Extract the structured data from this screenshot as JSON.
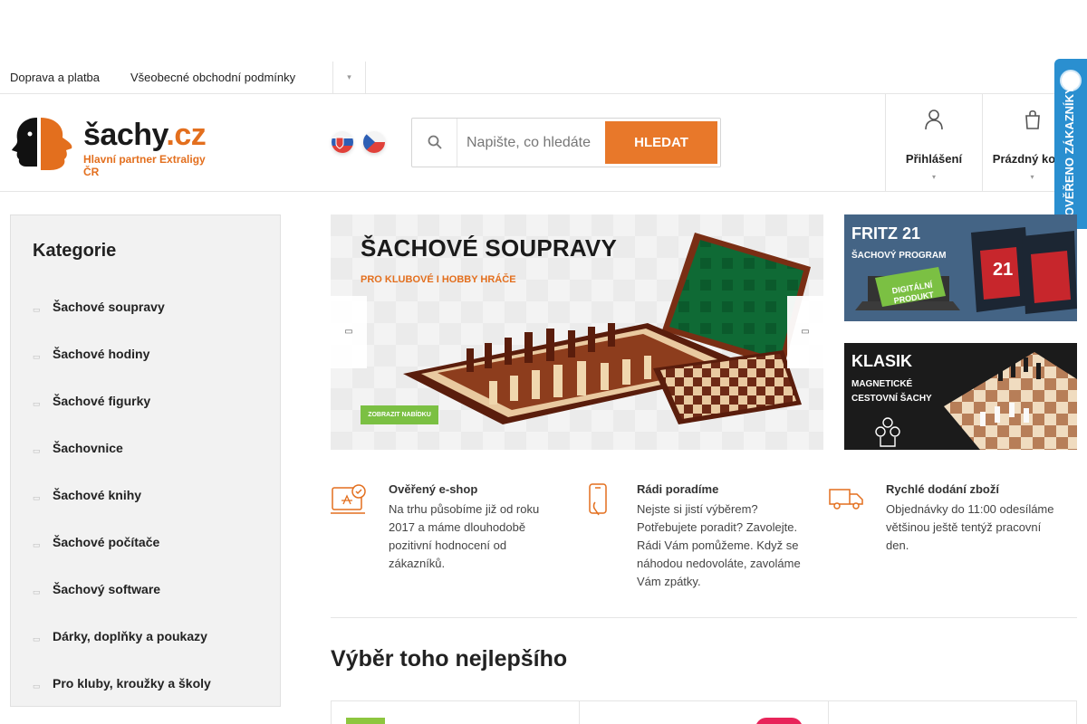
{
  "top_links": {
    "shipping": "Doprava a platba",
    "terms": "Všeobecné obchodní podmínky"
  },
  "logo": {
    "name": "šachy",
    "tld": ".cz",
    "tagline": "Hlavní partner Extraligy ČR"
  },
  "search": {
    "placeholder": "Napište, co hledáte",
    "button": "HLEDAT"
  },
  "header": {
    "login_label": "Přihlášení",
    "cart_label": "Prázdný košík"
  },
  "verified_badge": {
    "text": "OVĚŘENO ZÁKAZNÍKY"
  },
  "sidebar": {
    "title": "Kategorie",
    "items": [
      "Šachové soupravy",
      "Šachové hodiny",
      "Šachové figurky",
      "Šachovnice",
      "Šachové knihy",
      "Šachové počítače",
      "Šachový software",
      "Dárky, doplňky a poukazy",
      "Pro kluby, kroužky a školy"
    ]
  },
  "main_banner": {
    "title": "ŠACHOVÉ SOUPRAVY",
    "subtitle": "PRO KLUBOVÉ I HOBBY HRÁČE",
    "cta": "ZOBRAZIT NABÍDKU"
  },
  "side_banners": {
    "fritz": {
      "title": "FRITZ 21",
      "subtitle": "ŠACHOVÝ PROGRAM",
      "tag": "DIGITÁLNÍ PRODUKT",
      "box_number": "21"
    },
    "klasik": {
      "title": "KLASIK",
      "line1": "MAGNETICKÉ",
      "line2": "CESTOVNÍ ŠACHY"
    }
  },
  "features": [
    {
      "icon": "verified-shop-icon",
      "title": "Ověřený e-shop",
      "text": "Na trhu působíme již od roku 2017 a máme dlouhodobě pozitivní hodnocení od zákazníků."
    },
    {
      "icon": "phone-help-icon",
      "title": "Rádi poradíme",
      "text": "Nejste si jistí výběrem? Potřebujete poradit? Zavolejte. Rádi Vám pomůžeme. Když se náhodou nedovoláte, zavoláme Vám zpátky."
    },
    {
      "icon": "delivery-truck-icon",
      "title": "Rychlé dodání zboží",
      "text": "Objednávky do 11:00 odesíláme většinou ještě tentýž pracovní den."
    }
  ],
  "section": {
    "title": "Výběr toho nejlepšího"
  },
  "colors": {
    "accent": "#e8782a",
    "brand_orange": "#e36f1e",
    "badge_blue": "#2a8fd0",
    "cta_green": "#7bc043",
    "sidebar_bg": "#f2f2f2"
  }
}
